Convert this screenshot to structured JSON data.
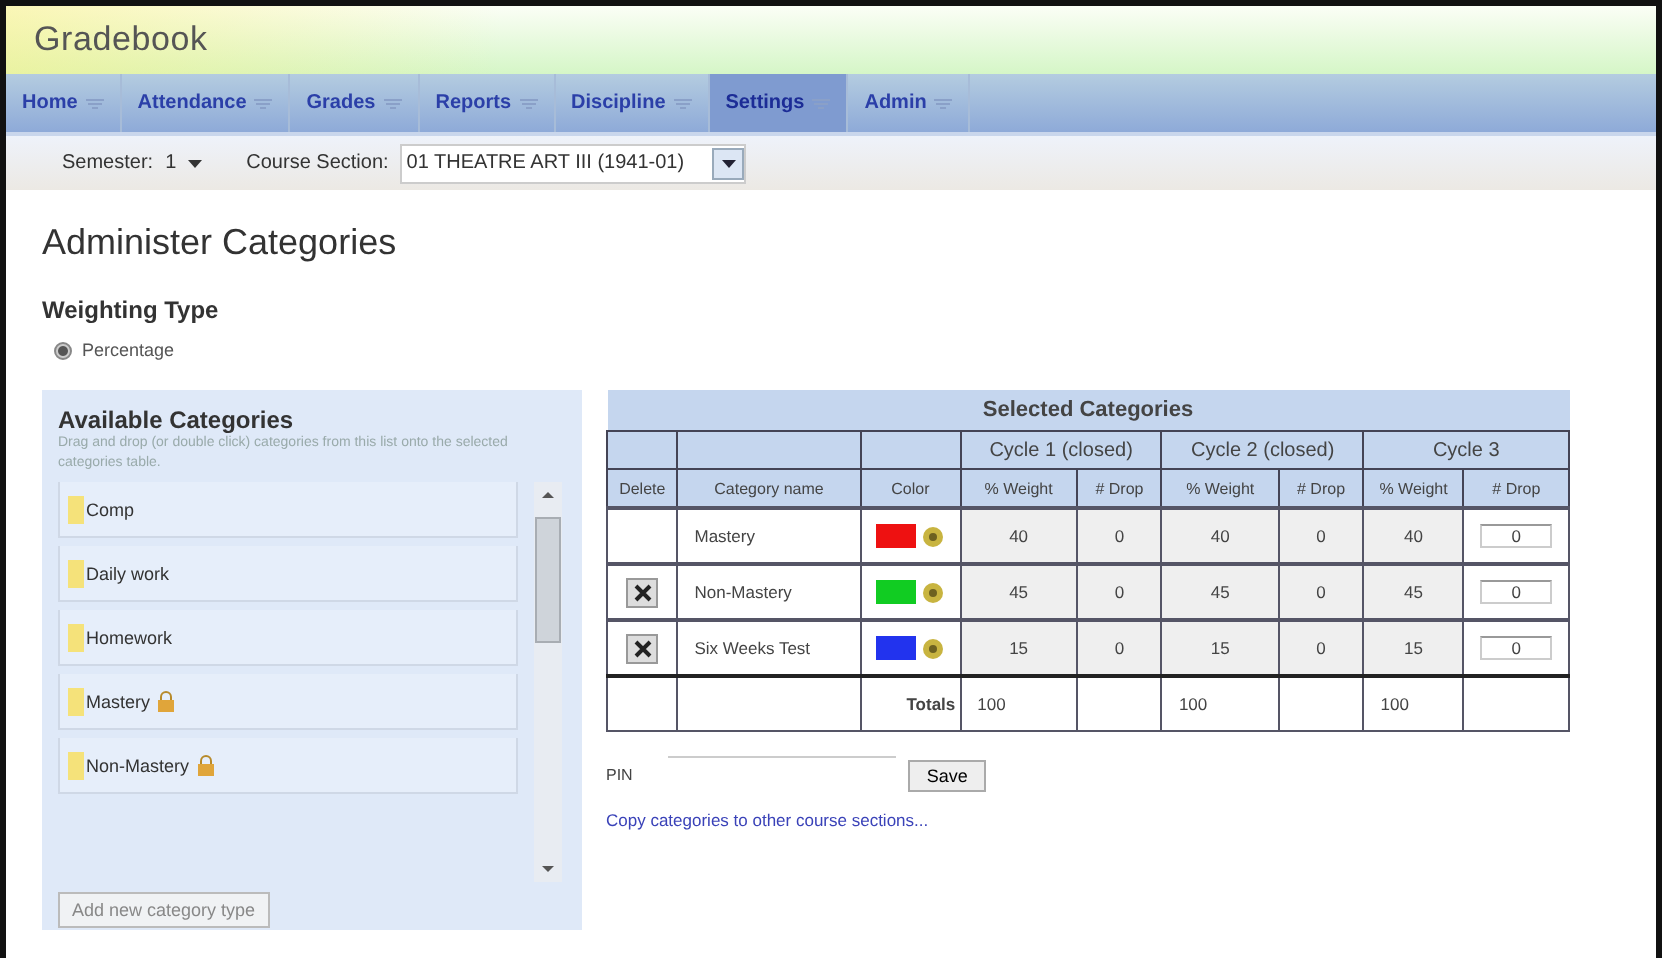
{
  "header": {
    "logo": "Gradebook"
  },
  "nav": [
    {
      "label": "Home",
      "selected": false
    },
    {
      "label": "Attendance",
      "selected": false
    },
    {
      "label": "Grades",
      "selected": false
    },
    {
      "label": "Reports",
      "selected": false
    },
    {
      "label": "Discipline",
      "selected": false
    },
    {
      "label": "Settings",
      "selected": true
    },
    {
      "label": "Admin",
      "selected": false
    }
  ],
  "filters": {
    "semester": {
      "label": "Semester:",
      "value": "1"
    },
    "course_section": {
      "label": "Course Section:",
      "value": "01 THEATRE ART III (1941-01)"
    }
  },
  "page_title": "Administer Categories",
  "weighting": {
    "title": "Weighting Type",
    "options": [
      {
        "label": "Percentage",
        "selected": true
      }
    ]
  },
  "available": {
    "title": "Available Categories",
    "description": "Drag and drop (or double click) categories from this list onto the selected categories table.",
    "items": [
      {
        "label": "Comp",
        "locked": false
      },
      {
        "label": "Daily work",
        "locked": false
      },
      {
        "label": "Homework",
        "locked": false
      },
      {
        "label": "Mastery",
        "locked": true
      },
      {
        "label": "Non-Mastery",
        "locked": true
      }
    ],
    "add_button": "Add new category type"
  },
  "selected_table": {
    "title": "Selected Categories",
    "cycles": [
      "Cycle 1 (closed)",
      "Cycle 2 (closed)",
      "Cycle 3"
    ],
    "columns": [
      "Delete",
      "Category name",
      "Color",
      "% Weight",
      "# Drop",
      "% Weight",
      "# Drop",
      "% Weight",
      "# Drop"
    ],
    "rows": [
      {
        "deletable": false,
        "name": "Mastery",
        "color": "#ee1111",
        "values": [
          "40",
          "0",
          "40",
          "0",
          "40",
          "0"
        ]
      },
      {
        "deletable": true,
        "name": "Non-Mastery",
        "color": "#11cc22",
        "values": [
          "45",
          "0",
          "45",
          "0",
          "45",
          "0"
        ]
      },
      {
        "deletable": true,
        "name": "Six Weeks Test",
        "color": "#2233ee",
        "values": [
          "15",
          "0",
          "15",
          "0",
          "15",
          "0"
        ]
      }
    ],
    "totals": {
      "label": "Totals",
      "cycles": [
        {
          "weight": "100"
        },
        {
          "weight": "100"
        },
        {
          "weight": "100"
        }
      ]
    }
  },
  "pin": {
    "label": "PIN"
  },
  "save_button": "Save",
  "copy_link": "Copy categories to other course sections..."
}
